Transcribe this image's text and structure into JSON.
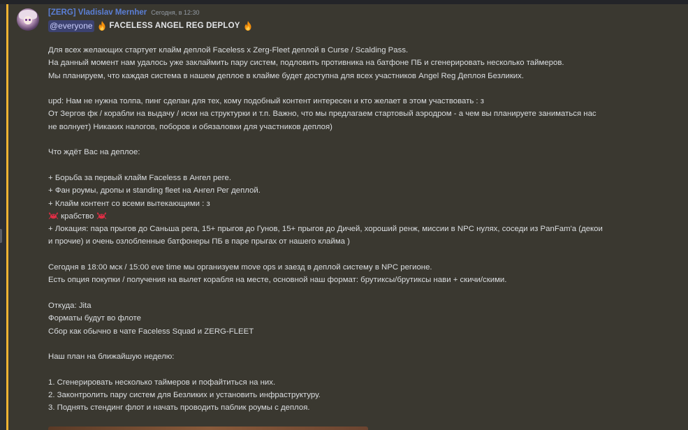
{
  "message": {
    "author": "[ZERG] Vladislav Mernher",
    "timestamp": "Сегодня, в 12:30",
    "mention": "@everyone",
    "title": "FACELESS ANGEL REG DEPLOY",
    "lines": [
      "Для всех желающих стартует клайм деплой Faceless x Zerg-Fleet деплой в Curse / Scalding Pass.",
      "На данный момент нам удалось уже заклаймить пару систем, подловить противника на батфоне ПБ и сгенерировать несколько таймеров.",
      "Мы планируем, что каждая система в нашем деплое в клайме будет доступна для всех участников Angel Reg Деплоя Безликих.",
      "",
      "upd: Нам не нужна толпа, пинг сделан для тех, кому подобный контент интересен и кто желает в этом участвовать : з",
      "От Зергов фк / корабли на выдачу / иски на структурки и т.п. Важно, что мы предлагаем стартовый аэродром - а чем вы планируете заниматься нас",
      "не волнует) Никаких налогов, поборов и обязаловки для участников деплоя)",
      "",
      "Что ждёт Вас на деплое:",
      "",
      "+ Борьба за первый клайм Faceless в Ангел реге.",
      "+ Фан роумы, дропы и standing fleet на Ангел Рег деплой.",
      "+ Клайм контент со всеми вытекающими : з",
      "крабство",
      "+ Локация: пара прыгов до Саньша рега, 15+ прыгов до Гунов, 15+ прыгов до Дичей, хороший ренж, миссии в NPC нулях, соседи из PanFam'a (декои",
      "и прочие) и очень озлобленные батфонеры ПБ в паре прыгах от нашего клайма )",
      "",
      "Сегодня в 18:00 мск / 15:00 eve time мы организуем move ops и заезд в деплой систему в NPC регионе.",
      "Есть опция покупки / получения на вылет корабля на месте, основной наш формат: брутиксы/брутиксы нави + скичи/скими.",
      "",
      "Откуда: Jita",
      "Форматы будут во флоте",
      "Сбор как обычно в чате Faceless Squad и ZERG-FLEET",
      "",
      "Наш план на ближайшую неделю:",
      "",
      "1. Сгенерировать несколько таймеров и пофайтиться на них.",
      "2. Законтролить пару систем для Безликих и установить инфраструктуру.",
      "3. Поднять стендинг флот и начать проводить паблик роумы с деплоя."
    ]
  },
  "icons": {
    "fire": "fire-icon",
    "crab": "crab-icon"
  },
  "colors": {
    "username": "#5b7fd6",
    "mention_bg": "#3c4270",
    "highlight": "#f0b232",
    "message_bg": "#3a3830"
  }
}
